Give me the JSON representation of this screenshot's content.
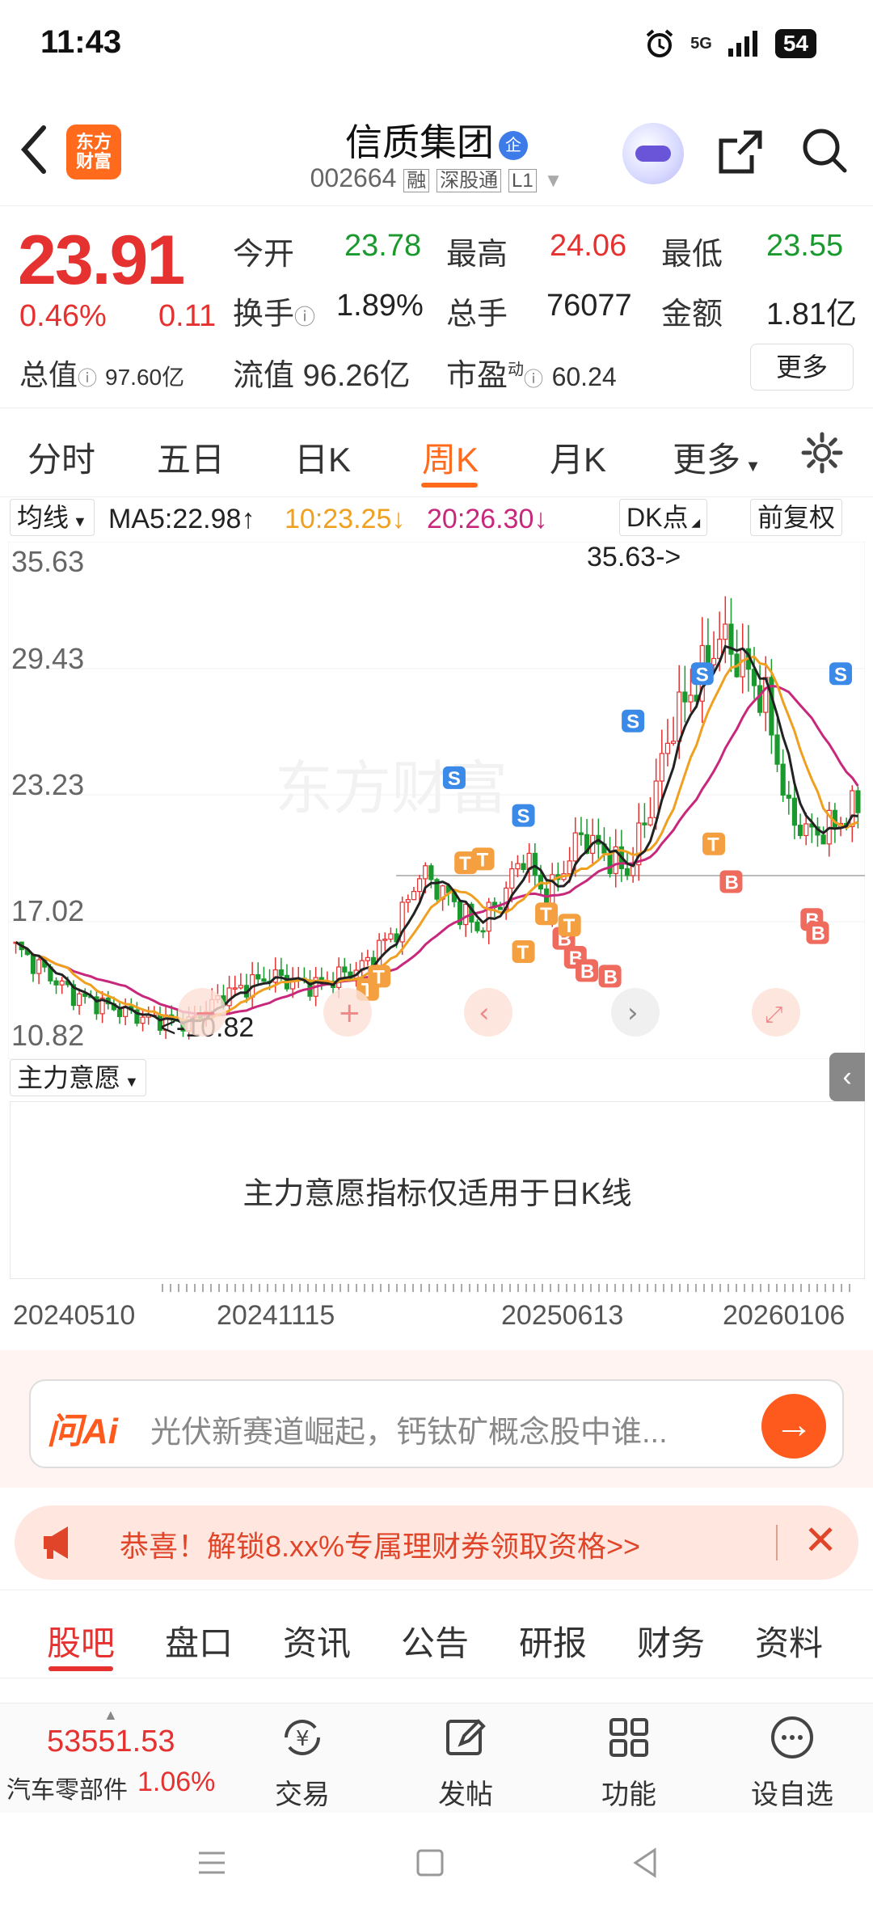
{
  "status_bar": {
    "time": "11:43",
    "network": "5G",
    "battery": "54"
  },
  "header": {
    "logo_line1": "东方",
    "logo_line2": "财富",
    "stock_name": "信质集团",
    "qi_badge": "企",
    "code": "002664",
    "tags": [
      "融",
      "深股通",
      "L1"
    ]
  },
  "quote": {
    "price": "23.91",
    "change_pct": "0.46%",
    "change": "0.11",
    "open_label": "今开",
    "open": "23.78",
    "high_label": "最高",
    "high": "24.06",
    "low_label": "最低",
    "low": "23.55",
    "turnover_label": "换手",
    "turnover": "1.89%",
    "volume_label": "总手",
    "volume": "76077",
    "amount_label": "金额",
    "amount": "1.81亿",
    "mcap_label": "总值",
    "mcap": "97.60亿",
    "float_label": "流值",
    "float_cap": "96.26亿",
    "pe_label": "市盈",
    "pe_sup": "动",
    "pe": "60.24",
    "more": "更多"
  },
  "period_tabs": [
    "分时",
    "五日",
    "日K",
    "周K",
    "月K",
    "更多"
  ],
  "active_tab": "周K",
  "ma_bar": {
    "select": "均线",
    "ma5": "MA5:22.98",
    "ma10": "10:23.25",
    "ma20": "20:26.30",
    "dk": "DK点",
    "adjust": "前复权"
  },
  "chart": {
    "y_labels": [
      "35.63",
      "29.43",
      "23.23",
      "17.02",
      "10.82"
    ],
    "max_label": "35.63->",
    "min_label": "<-10.82",
    "watermark": "东方财富",
    "colors": {
      "up": "#e5312f",
      "down": "#1a9a2e",
      "ma5": "#222222",
      "ma10": "#f0a020",
      "ma20": "#c8287c"
    }
  },
  "indicator": {
    "select": "主力意愿",
    "message": "主力意愿指标仅适用于日K线"
  },
  "x_dates": [
    "20240510",
    "20241115",
    "20250613",
    "20260106"
  ],
  "ai": {
    "logo": "问Ai",
    "placeholder": "光伏新赛道崛起，钙钛矿概念股中谁..."
  },
  "promo": {
    "text": "恭喜！解锁8.xx%专属理财券领取资格>>"
  },
  "bottom_tabs": [
    "股吧",
    "盘口",
    "资讯",
    "公告",
    "研报",
    "财务",
    "资料"
  ],
  "dock": {
    "index_value": "53551.53",
    "index_name": "汽车零部件",
    "index_pct": "1.06%",
    "items": [
      "交易",
      "发帖",
      "功能",
      "设自选"
    ]
  }
}
